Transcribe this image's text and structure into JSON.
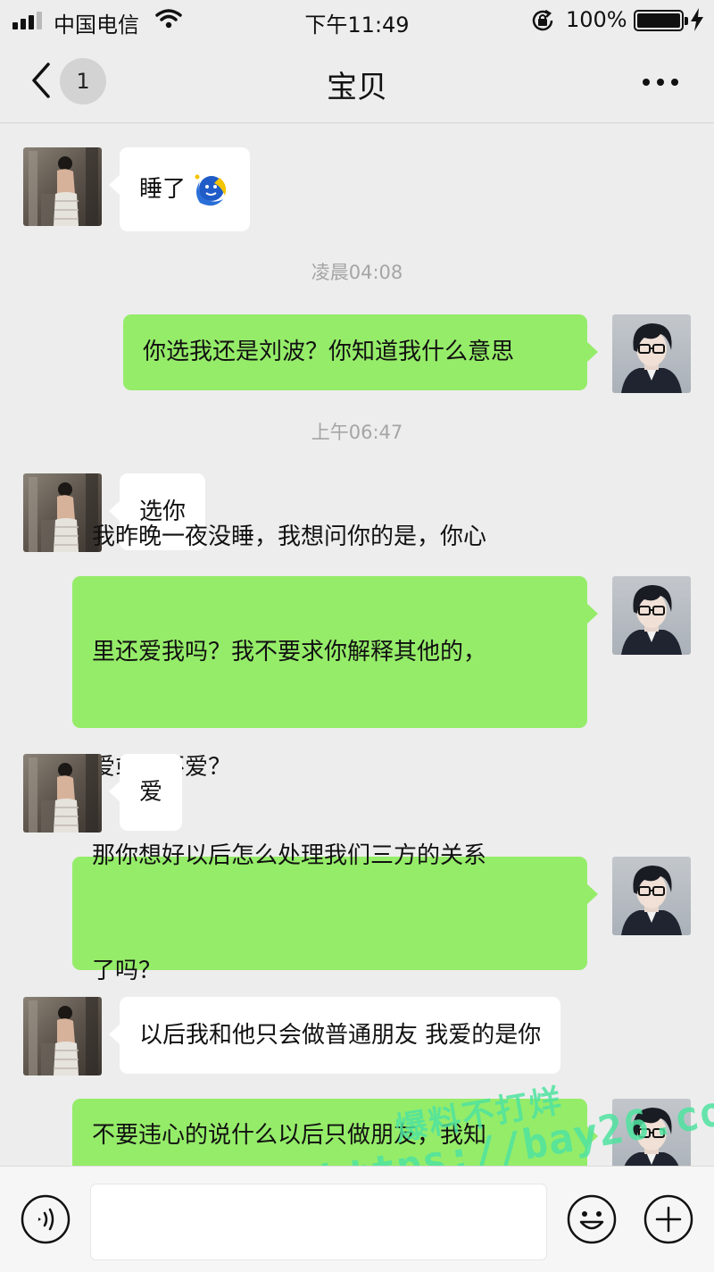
{
  "status_bar": {
    "carrier": "中国电信",
    "time": "下午11:49",
    "battery_percent": "100%",
    "battery_level": 1.0,
    "signal_bars": 3,
    "signal_bars_total": 4,
    "icons": [
      "signal-icon",
      "wifi-icon",
      "orientation-lock-icon",
      "battery-icon",
      "charging-icon"
    ]
  },
  "nav": {
    "unread_count": "1",
    "title": "宝贝",
    "icons": [
      "back-chevron-icon",
      "more-icon"
    ]
  },
  "messages": [
    {
      "kind": "message",
      "side": "incoming",
      "text": "睡了",
      "emoji": "moon-face-icon"
    },
    {
      "kind": "timestamp",
      "text": "凌晨04:08"
    },
    {
      "kind": "message",
      "side": "outgoing",
      "text": "你选我还是刘波？你知道我什么意思"
    },
    {
      "kind": "timestamp",
      "text": "上午06:47"
    },
    {
      "kind": "message",
      "side": "incoming",
      "text": "选你"
    },
    {
      "kind": "message",
      "side": "outgoing",
      "lines": [
        "我昨晚一夜没睡，我想问你的是，你心",
        "里还爱我吗？我不要求你解释其他的，",
        "爱或者不爱？"
      ]
    },
    {
      "kind": "message",
      "side": "incoming",
      "text": "爱"
    },
    {
      "kind": "message",
      "side": "outgoing",
      "lines": [
        "那你想好以后怎么处理我们三方的关系",
        "了吗？"
      ]
    },
    {
      "kind": "message",
      "side": "incoming",
      "text": "以后我和他只会做普通朋友 我爱的是你"
    },
    {
      "kind": "message",
      "side": "outgoing",
      "text": "不要违心的说什么以后只做朋友，我知"
    }
  ],
  "watermark": {
    "line1": "爆料不打烊",
    "line2": "https://bay26.co"
  },
  "input_bar": {
    "icons": [
      "voice-icon",
      "emoji-icon",
      "plus-icon"
    ]
  },
  "colors": {
    "background": "#ededed",
    "outgoing_bubble": "#95ec69",
    "incoming_bubble": "#ffffff",
    "timestamp_text": "#a5a5a5",
    "watermark": "#4fe3a0"
  }
}
